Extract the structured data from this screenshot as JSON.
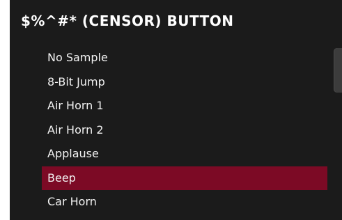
{
  "panel": {
    "title": "$%^#* (CENSOR) BUTTON"
  },
  "sound_list": {
    "items": [
      {
        "label": "No Sample",
        "selected": false
      },
      {
        "label": "8-Bit Jump",
        "selected": false
      },
      {
        "label": "Air Horn 1",
        "selected": false
      },
      {
        "label": "Air Horn 2",
        "selected": false
      },
      {
        "label": "Applause",
        "selected": false
      },
      {
        "label": "Beep",
        "selected": true
      },
      {
        "label": "Car Horn",
        "selected": false
      }
    ],
    "selected_color": "#7c0a25"
  }
}
